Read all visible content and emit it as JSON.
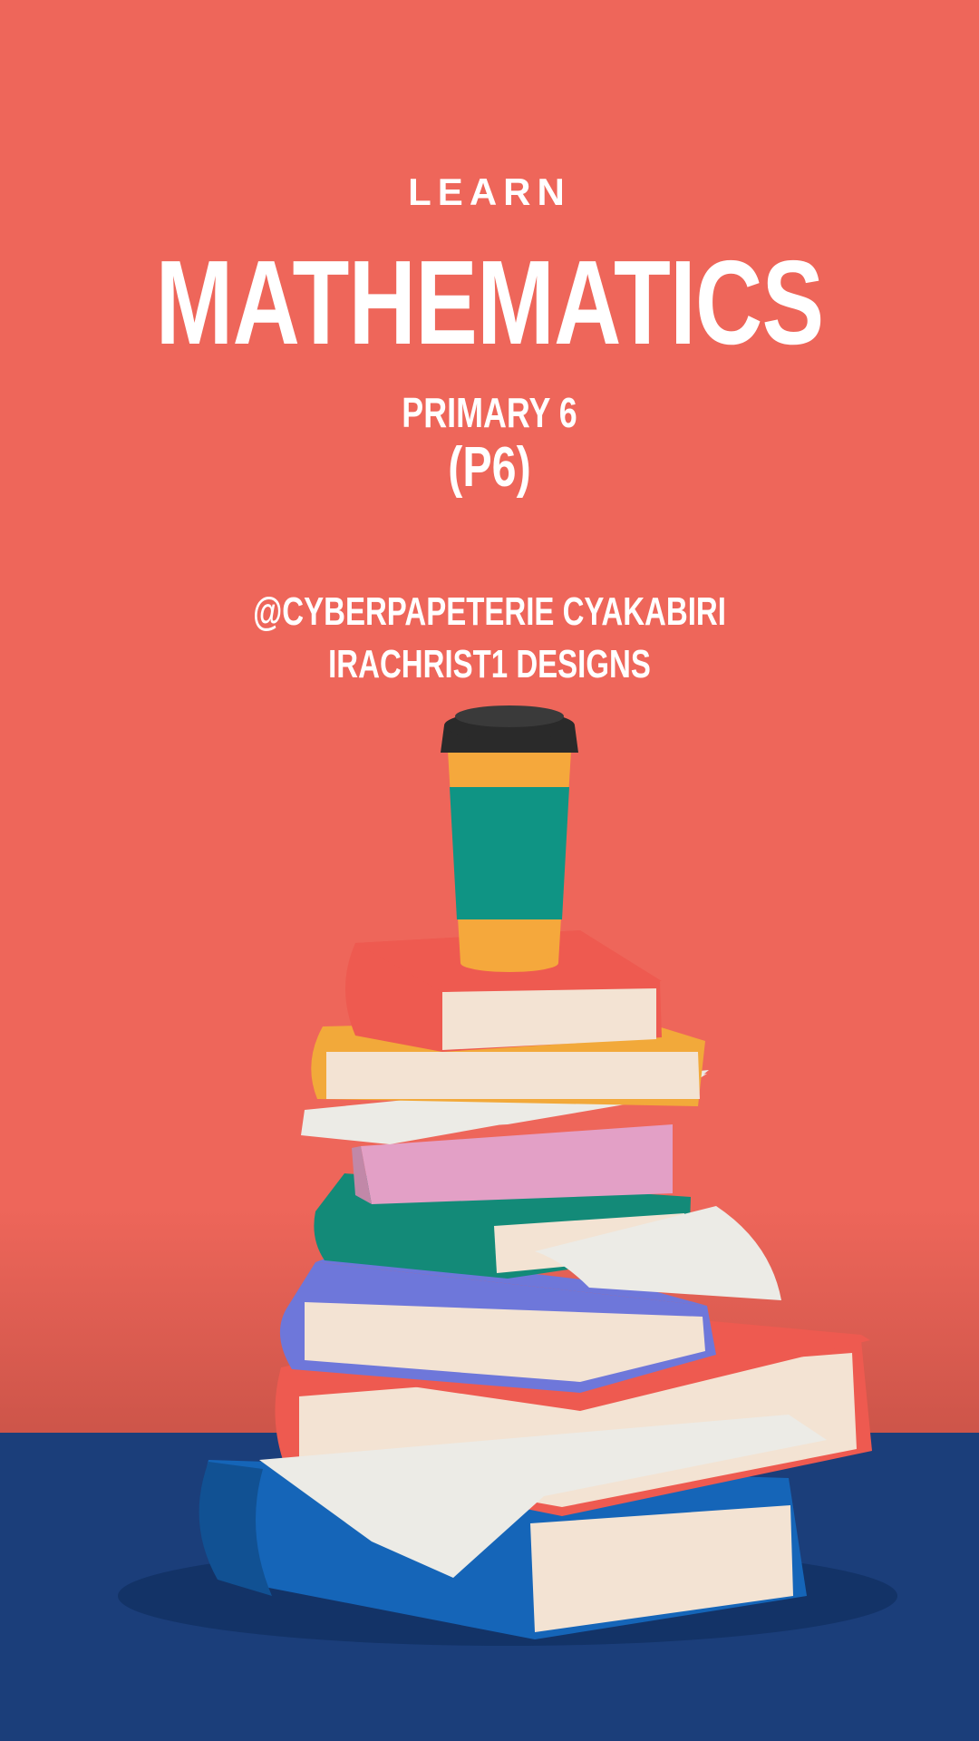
{
  "poster": {
    "eyebrow": "LEARN",
    "headline": "MATHEMATICS",
    "grade_line": "PRIMARY 6",
    "grade_code": "(P6)",
    "credit_line_1": "@CYBERPAPETERIE CYAKABIRI",
    "credit_line_2": "IRACHRIST1 DESIGNS"
  },
  "colors": {
    "wall": "#EE665A",
    "floor": "#1B3E7A",
    "text": "#FFFFFF",
    "book_red": "#EE5A50",
    "book_yellow": "#F2A93A",
    "book_pink": "#E3A0C6",
    "book_green": "#138A78",
    "book_purple": "#6E77DA",
    "book_blue": "#1565B8",
    "pages": "#F3E3D3",
    "paper": "#ECEBE6",
    "cup_lid": "#2A2A2A",
    "cup_body": "#F5A83C",
    "cup_sleeve": "#0F9484"
  },
  "illustration": {
    "icon": "book-stack-with-coffee-cup-icon"
  }
}
